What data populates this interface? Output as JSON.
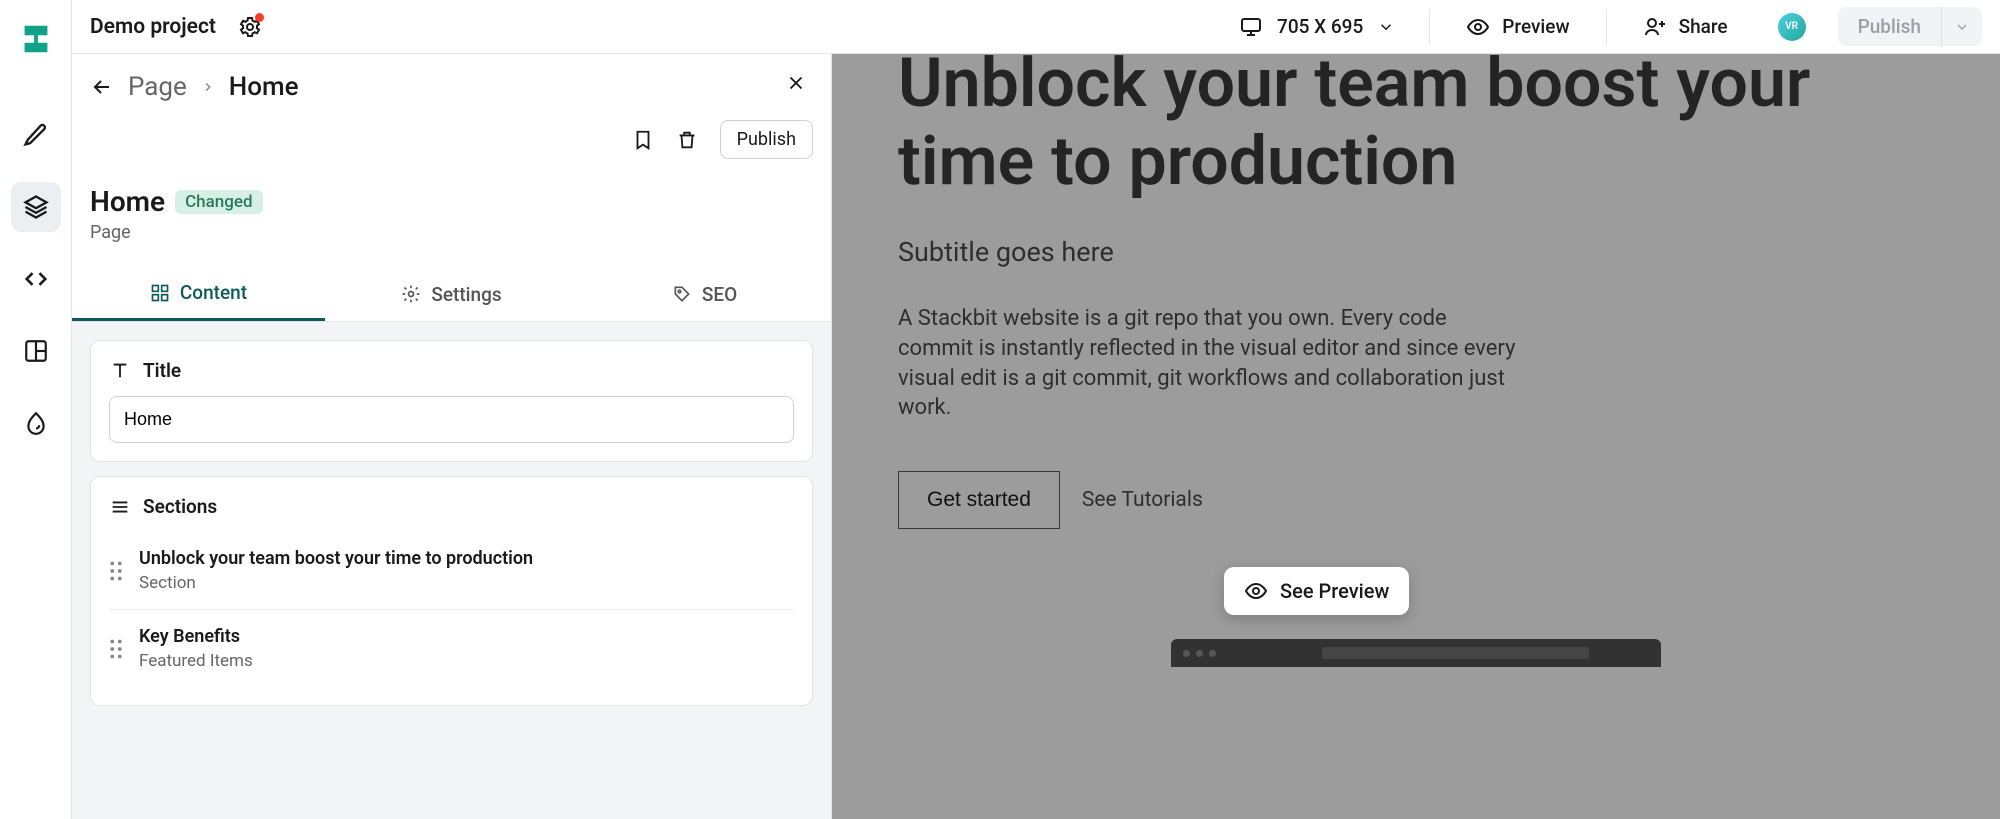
{
  "project_name": "Demo project",
  "viewport_label": "705 X 695",
  "topbar": {
    "preview": "Preview",
    "share": "Share",
    "publish": "Publish",
    "avatar_initials": "VR"
  },
  "breadcrumb": {
    "parent": "Page",
    "current": "Home"
  },
  "panel": {
    "publish": "Publish",
    "title": "Home",
    "badge": "Changed",
    "subtitle": "Page"
  },
  "tabs": {
    "content": "Content",
    "settings": "Settings",
    "seo": "SEO"
  },
  "fields": {
    "title_label": "Title",
    "title_value": "Home",
    "sections_label": "Sections",
    "sections": [
      {
        "title": "Unblock your team boost your time to production",
        "type": "Section"
      },
      {
        "title": "Key Benefits",
        "type": "Featured Items"
      }
    ]
  },
  "hero": {
    "heading": "Unblock your team boost your time to production",
    "subtitle": "Subtitle goes here",
    "body": "A Stackbit website is a git repo that you own. Every code commit is instantly reflected in the visual editor and since every visual edit is a git commit, git workflows and collaboration just work.",
    "cta_primary": "Get started",
    "cta_secondary": "See Tutorials"
  },
  "popover": {
    "label": "See Preview"
  }
}
